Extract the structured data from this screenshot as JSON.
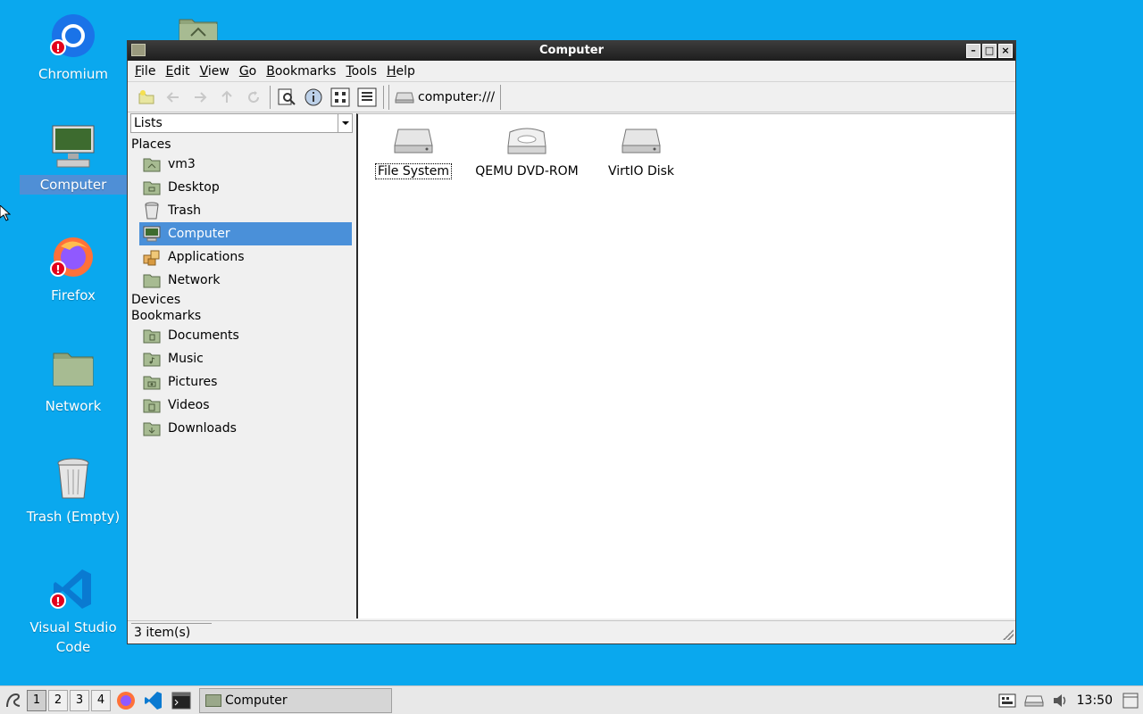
{
  "desktop": {
    "icons": [
      {
        "label": "Chromium"
      },
      {
        "label": "Computer"
      },
      {
        "label": "Firefox"
      },
      {
        "label": "Network"
      },
      {
        "label": "Trash (Empty)"
      },
      {
        "label": "Visual Studio Code"
      }
    ]
  },
  "window": {
    "title": "Computer",
    "menus": [
      {
        "ul": "F",
        "rest": "ile"
      },
      {
        "ul": "E",
        "rest": "dit"
      },
      {
        "ul": "V",
        "rest": "iew"
      },
      {
        "ul": "G",
        "rest": "o"
      },
      {
        "ul": "B",
        "rest": "ookmarks"
      },
      {
        "ul": "T",
        "rest": "ools"
      },
      {
        "ul": "H",
        "rest": "elp"
      }
    ],
    "location": "computer:///",
    "sidebar": {
      "combo_value": "Lists",
      "places_header": "Places",
      "places": [
        "vm3",
        "Desktop",
        "Trash",
        "Computer",
        "Applications",
        "Network"
      ],
      "devices_header": "Devices",
      "bookmarks_header": "Bookmarks",
      "bookmarks": [
        "Documents",
        "Music",
        "Pictures",
        "Videos",
        "Downloads"
      ]
    },
    "files": [
      "File System",
      "QEMU DVD-ROM",
      "VirtIO Disk"
    ],
    "status": "3 item(s)"
  },
  "taskbar": {
    "workspaces": [
      "1",
      "2",
      "3",
      "4"
    ],
    "task_label": "Computer",
    "clock": "13:50"
  },
  "colors": {
    "desktop_bg": "#0aa8ee",
    "selection": "#4a90d9"
  }
}
